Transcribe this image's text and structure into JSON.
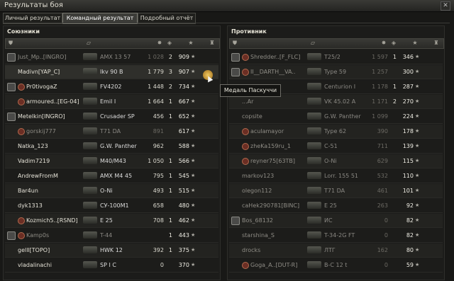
{
  "window": {
    "title": "Результаты боя",
    "close_icon": "close-icon"
  },
  "tabs": [
    {
      "label": "Личный результат",
      "active": false
    },
    {
      "label": "Командный результат",
      "active": true
    },
    {
      "label": "Подробный отчёт",
      "active": false
    }
  ],
  "left": {
    "title": "Союзники",
    "rows": [
      {
        "player": "Just_Mp..[INGRO]",
        "tank": "AMX 13 57",
        "dmg": "1 028",
        "kills": "2",
        "xp": "909",
        "dead": true,
        "platoon": true,
        "rank": false
      },
      {
        "player": "Madivn[YAP_C]",
        "tank": "Ikv 90 B",
        "dmg": "1 779",
        "kills": "3",
        "xp": "907",
        "dead": false,
        "platoon": false,
        "rank": false
      },
      {
        "player": "Pr0tivogaZ",
        "tank": "FV4202",
        "dmg": "1 448",
        "kills": "2",
        "xp": "734",
        "dead": false,
        "platoon": true,
        "rank": true
      },
      {
        "player": "armoured..[EG-04]",
        "tank": "Emil I",
        "dmg": "1 664",
        "kills": "1",
        "xp": "667",
        "dead": false,
        "platoon": false,
        "rank": true
      },
      {
        "player": "Metelkin[INGRO]",
        "tank": "Crusader SP",
        "dmg": "456",
        "kills": "1",
        "xp": "652",
        "dead": false,
        "platoon": true,
        "rank": false
      },
      {
        "player": "gorskij777",
        "tank": "T71 DA",
        "dmg": "891",
        "kills": "",
        "xp": "617",
        "dead": true,
        "platoon": false,
        "rank": true
      },
      {
        "player": "Natka_123",
        "tank": "G.W. Panther",
        "dmg": "962",
        "kills": "",
        "xp": "588",
        "dead": false,
        "platoon": false,
        "rank": false
      },
      {
        "player": "Vadim7219",
        "tank": "M40/M43",
        "dmg": "1 050",
        "kills": "1",
        "xp": "566",
        "dead": false,
        "platoon": false,
        "rank": false
      },
      {
        "player": "AndrewFromM",
        "tank": "AMX M4 45",
        "dmg": "795",
        "kills": "1",
        "xp": "545",
        "dead": false,
        "platoon": false,
        "rank": false
      },
      {
        "player": "Bar4un",
        "tank": "O-Ni",
        "dmg": "493",
        "kills": "1",
        "xp": "515",
        "dead": false,
        "platoon": false,
        "rank": false
      },
      {
        "player": "dyk1313",
        "tank": "СУ-100М1",
        "dmg": "658",
        "kills": "",
        "xp": "480",
        "dead": false,
        "platoon": false,
        "rank": false
      },
      {
        "player": "Kozmich5..[RSND]",
        "tank": "E 25",
        "dmg": "708",
        "kills": "1",
        "xp": "462",
        "dead": false,
        "platoon": false,
        "rank": true
      },
      {
        "player": "Kamp0s",
        "tank": "T-44",
        "dmg": "",
        "kills": "1",
        "xp": "443",
        "dead": true,
        "platoon": true,
        "rank": true
      },
      {
        "player": "gelll[TOPO]",
        "tank": "HWK 12",
        "dmg": "392",
        "kills": "1",
        "xp": "375",
        "dead": false,
        "platoon": false,
        "rank": false
      },
      {
        "player": "vladalinachi",
        "tank": "SP I C",
        "dmg": "0",
        "kills": "",
        "xp": "370",
        "dead": false,
        "platoon": false,
        "rank": false
      }
    ]
  },
  "right": {
    "title": "Противник",
    "rows": [
      {
        "player": "Shredder..[F_FLC]",
        "tank": "T25/2",
        "dmg": "1 597",
        "kills": "1",
        "xp": "346",
        "dead": true,
        "platoon": true,
        "rank": true
      },
      {
        "player": "II__DARTH__VA..",
        "tank": "Type 59",
        "dmg": "1 257",
        "kills": "",
        "xp": "300",
        "dead": true,
        "platoon": true,
        "rank": true
      },
      {
        "player": "..relok",
        "tank": "Centurion I",
        "dmg": "1 178",
        "kills": "1",
        "xp": "287",
        "dead": true,
        "platoon": false,
        "rank": false
      },
      {
        "player": "...Ar",
        "tank": "VK 45.02 A",
        "dmg": "1 171",
        "kills": "2",
        "xp": "270",
        "dead": true,
        "platoon": false,
        "rank": false
      },
      {
        "player": "copsite",
        "tank": "G.W. Panther",
        "dmg": "1 099",
        "kills": "",
        "xp": "224",
        "dead": true,
        "platoon": false,
        "rank": false
      },
      {
        "player": "aculamayor",
        "tank": "Type 62",
        "dmg": "390",
        "kills": "",
        "xp": "178",
        "dead": true,
        "platoon": false,
        "rank": true
      },
      {
        "player": "zheKa159ru_1",
        "tank": "C-51",
        "dmg": "711",
        "kills": "",
        "xp": "139",
        "dead": true,
        "platoon": false,
        "rank": true
      },
      {
        "player": "reyner75[63TB]",
        "tank": "O-Ni",
        "dmg": "629",
        "kills": "",
        "xp": "115",
        "dead": true,
        "platoon": false,
        "rank": true
      },
      {
        "player": "markov123",
        "tank": "Lorr. 155 51",
        "dmg": "532",
        "kills": "",
        "xp": "110",
        "dead": true,
        "platoon": false,
        "rank": false
      },
      {
        "player": "olegon112",
        "tank": "T71 DA",
        "dmg": "461",
        "kills": "",
        "xp": "101",
        "dead": true,
        "platoon": false,
        "rank": false
      },
      {
        "player": "caHek290781[BINC]",
        "tank": "E 25",
        "dmg": "263",
        "kills": "",
        "xp": "92",
        "dead": true,
        "platoon": false,
        "rank": false
      },
      {
        "player": "Bos_68132",
        "tank": "ИС",
        "dmg": "0",
        "kills": "",
        "xp": "82",
        "dead": true,
        "platoon": true,
        "rank": false
      },
      {
        "player": "starshina_S",
        "tank": "T-34-2G FT",
        "dmg": "0",
        "kills": "",
        "xp": "82",
        "dead": true,
        "platoon": false,
        "rank": false
      },
      {
        "player": "drocks",
        "tank": "ЛТГ",
        "dmg": "162",
        "kills": "",
        "xp": "80",
        "dead": true,
        "platoon": false,
        "rank": false
      },
      {
        "player": "Goga_A..[DUT-R]",
        "tank": "B-C 12 t",
        "dmg": "0",
        "kills": "",
        "xp": "59",
        "dead": true,
        "platoon": false,
        "rank": true
      }
    ]
  },
  "tooltip": {
    "text": "Медаль Паскуччи"
  }
}
